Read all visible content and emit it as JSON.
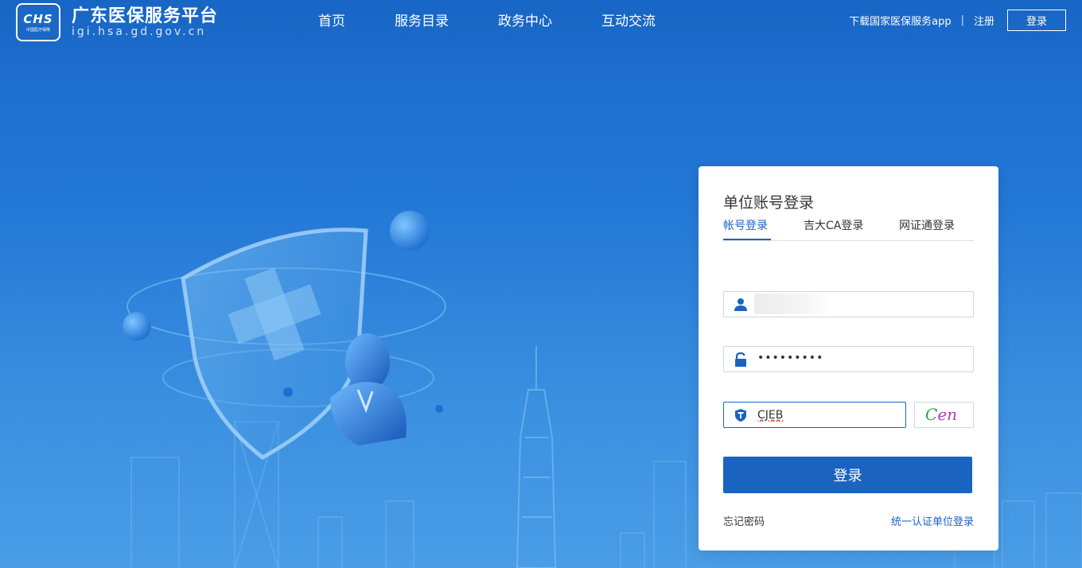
{
  "header": {
    "logo_mark": "CHS",
    "logo_sub": "中国医疗保障",
    "site_title": "广东医保服务平台",
    "site_domain": "igi.hsa.gd.gov.cn",
    "nav": [
      "首页",
      "服务目录",
      "政务中心",
      "互动交流"
    ],
    "download_link": "下载国家医保服务app",
    "separator": "|",
    "register": "注册",
    "login": "登录"
  },
  "login_card": {
    "title": "单位账号登录",
    "tabs": [
      "帐号登录",
      "吉大CA登录",
      "网证通登录"
    ],
    "active_tab": 0,
    "username_value": "",
    "password_value": "•••••••••",
    "captcha_value": "CJEB",
    "captcha_image_text": "Cen",
    "submit_label": "登录",
    "forgot_password": "忘记密码",
    "unified_login": "统一认证单位登录"
  },
  "colors": {
    "primary": "#1a64c0",
    "header_bg": "#1765c4",
    "page_bg_top": "#1c69c8",
    "page_bg_bottom": "#4a9de6"
  }
}
